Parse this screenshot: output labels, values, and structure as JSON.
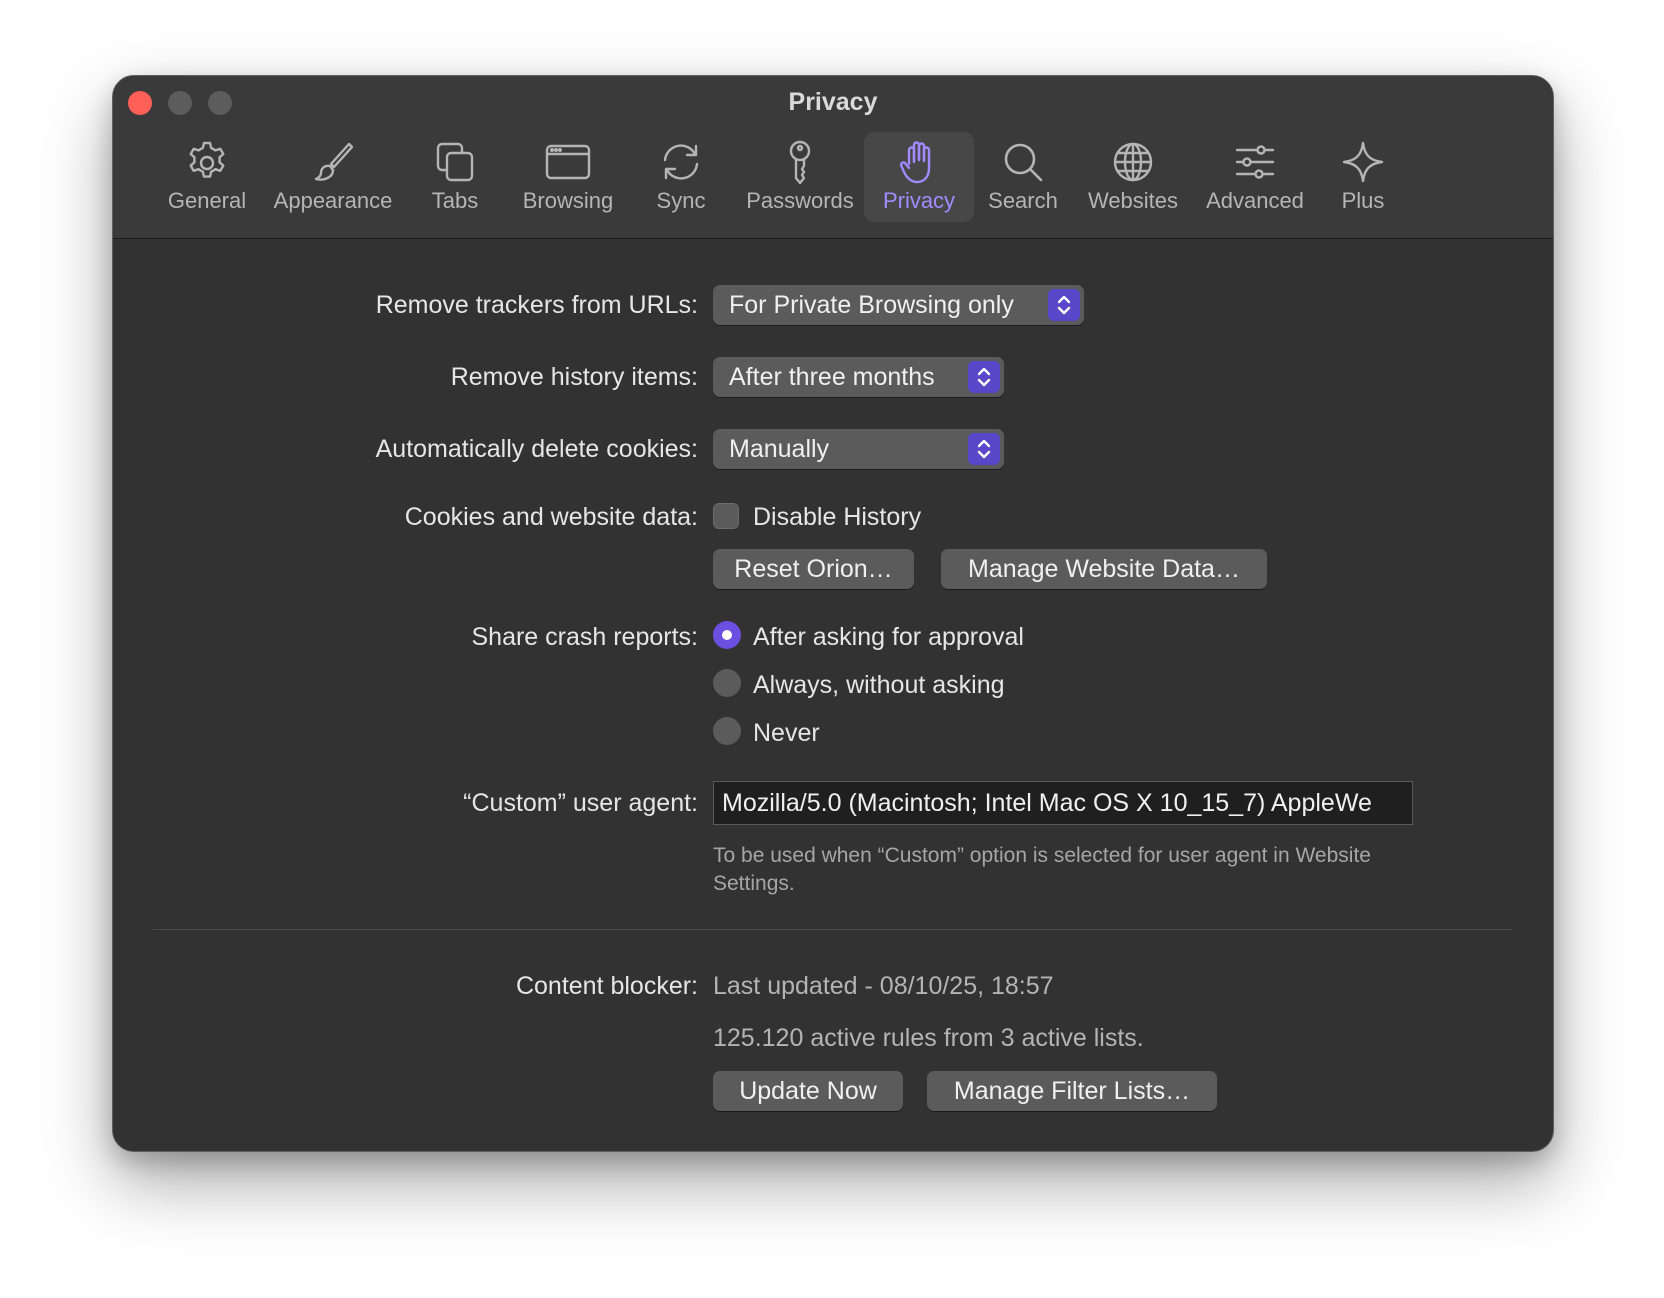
{
  "window": {
    "title": "Privacy"
  },
  "toolbar": {
    "tabs": [
      {
        "label": "General",
        "icon": "gear-icon"
      },
      {
        "label": "Appearance",
        "icon": "paintbrush-icon"
      },
      {
        "label": "Tabs",
        "icon": "tabs-icon"
      },
      {
        "label": "Browsing",
        "icon": "browser-window-icon"
      },
      {
        "label": "Sync",
        "icon": "sync-icon"
      },
      {
        "label": "Passwords",
        "icon": "key-icon"
      },
      {
        "label": "Privacy",
        "icon": "hand-icon",
        "active": true
      },
      {
        "label": "Search",
        "icon": "magnifier-icon"
      },
      {
        "label": "Websites",
        "icon": "globe-icon"
      },
      {
        "label": "Advanced",
        "icon": "sliders-icon"
      },
      {
        "label": "Plus",
        "icon": "sparkle-icon"
      }
    ]
  },
  "settings": {
    "trackers": {
      "label": "Remove trackers from URLs:",
      "value": "For Private Browsing only"
    },
    "history": {
      "label": "Remove history items:",
      "value": "After three months"
    },
    "cookies_delete": {
      "label": "Automatically delete cookies:",
      "value": "Manually"
    },
    "cookies_data": {
      "label": "Cookies and website data:",
      "disable_history_label": "Disable History",
      "disable_history_checked": false,
      "reset_button": "Reset Orion…",
      "manage_button": "Manage Website Data…"
    },
    "crash_reports": {
      "label": "Share crash reports:",
      "options": [
        {
          "label": "After asking for approval",
          "checked": true
        },
        {
          "label": "Always, without asking",
          "checked": false
        },
        {
          "label": "Never",
          "checked": false
        }
      ]
    },
    "user_agent": {
      "label": "“Custom” user agent:",
      "value": "Mozilla/5.0 (Macintosh; Intel Mac OS X 10_15_7) AppleWe",
      "hint": "To be used when “Custom” option is selected for user agent in Website Settings."
    },
    "content_blocker": {
      "label": "Content blocker:",
      "last_updated": "Last updated - 08/10/25, 18:57",
      "rules": "125.120 active rules from 3 active lists.",
      "update_button": "Update Now",
      "manage_button": "Manage Filter Lists…"
    }
  },
  "colors": {
    "accent": "#6a4fe0",
    "active_tab_text": "#a08cff",
    "close_button": "#fe5f57",
    "window_bg": "#323232"
  }
}
